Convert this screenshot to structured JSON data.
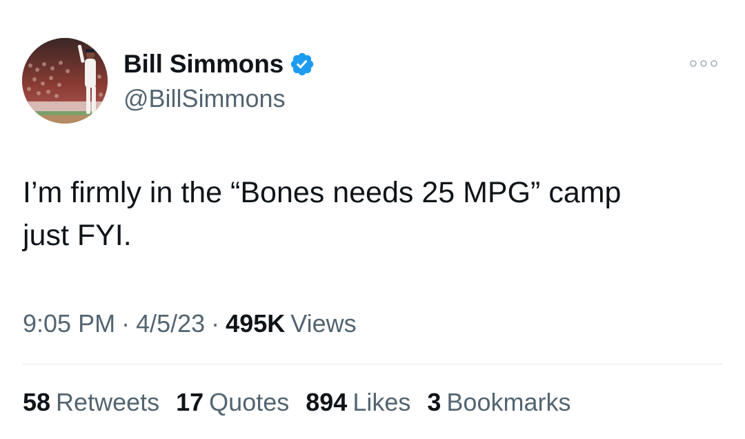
{
  "author": {
    "display_name": "Bill Simmons",
    "handle": "@BillSimmons",
    "verified": true,
    "avatar_icon": "baseball-player-avatar"
  },
  "more_icon": "more-horizontal-icon",
  "tweet": {
    "text": "I’m firmly in the “Bones needs 25 MPG” camp\njust FYI."
  },
  "meta": {
    "time": "9:05 PM",
    "separator": "·",
    "date": "4/5/23",
    "views_count": "495K",
    "views_label": "Views"
  },
  "stats": {
    "retweets_count": "58",
    "retweets_label": "Retweets",
    "quotes_count": "17",
    "quotes_label": "Quotes",
    "likes_count": "894",
    "likes_label": "Likes",
    "bookmarks_count": "3",
    "bookmarks_label": "Bookmarks"
  },
  "colors": {
    "verified_badge": "#1d9bf0",
    "primary_text": "#0f1419",
    "secondary_text": "#536471"
  }
}
